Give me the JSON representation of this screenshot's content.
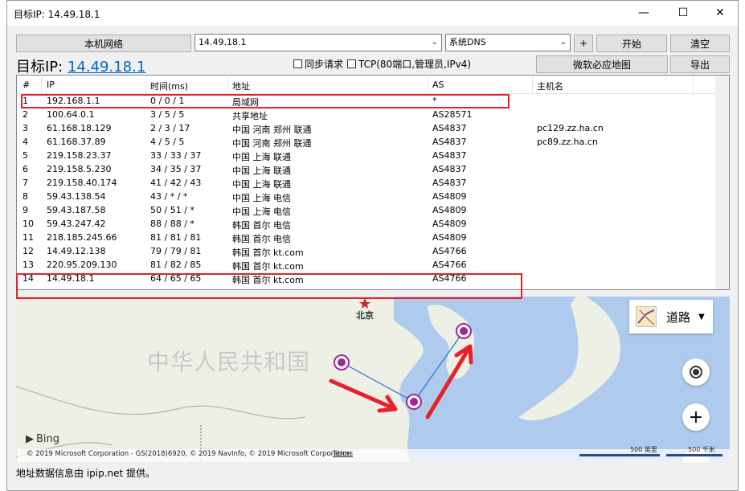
{
  "window": {
    "title": "目标IP: 14.49.18.1"
  },
  "toolbar": {
    "local_network": "本机网络",
    "ip_input_value": "14.49.18.1",
    "dns_select": "系统DNS",
    "plus": "+",
    "start": "开始",
    "clear": "清空",
    "bing_map": "微软必应地图",
    "export": "导出"
  },
  "target": {
    "label": "目标IP: ",
    "ip": "14.49.18.1"
  },
  "options": {
    "sync": "同步请求",
    "tcp": "TCP(80端口,管理员,IPv4)"
  },
  "table": {
    "headers": [
      "#",
      "IP",
      "时间(ms)",
      "地址",
      "AS",
      "主机名"
    ],
    "rows": [
      {
        "n": "1",
        "ip": "192.168.1.1",
        "time": "0 / 0 / 1",
        "addr": "局域网",
        "as": "*",
        "host": ""
      },
      {
        "n": "2",
        "ip": "100.64.0.1",
        "time": "3 / 5 / 5",
        "addr": "共享地址",
        "as": "AS28571",
        "host": ""
      },
      {
        "n": "3",
        "ip": "61.168.18.129",
        "time": "2 / 3 / 17",
        "addr": "中国 河南 郑州 联通",
        "as": "AS4837",
        "host": "pc129.zz.ha.cn"
      },
      {
        "n": "4",
        "ip": "61.168.37.89",
        "time": "4 / 5 / 5",
        "addr": "中国 河南 郑州 联通",
        "as": "AS4837",
        "host": "pc89.zz.ha.cn"
      },
      {
        "n": "5",
        "ip": "219.158.23.37",
        "time": "33 / 33 / 37",
        "addr": "中国 上海 联通",
        "as": "AS4837",
        "host": ""
      },
      {
        "n": "6",
        "ip": "219.158.5.230",
        "time": "34 / 35 / 37",
        "addr": "中国 上海 联通",
        "as": "AS4837",
        "host": ""
      },
      {
        "n": "7",
        "ip": "219.158.40.174",
        "time": "41 / 42 / 43",
        "addr": "中国 上海 联通",
        "as": "AS4837",
        "host": ""
      },
      {
        "n": "8",
        "ip": "59.43.138.54",
        "time": "43 / * / *",
        "addr": "中国 上海 电信",
        "as": "AS4809",
        "host": ""
      },
      {
        "n": "9",
        "ip": "59.43.187.58",
        "time": "50 / 51 / *",
        "addr": "中国 上海 电信",
        "as": "AS4809",
        "host": ""
      },
      {
        "n": "10",
        "ip": "59.43.247.42",
        "time": "88 / 88 / *",
        "addr": "韩国 首尔 电信",
        "as": "AS4809",
        "host": ""
      },
      {
        "n": "11",
        "ip": "218.185.245.66",
        "time": "81 / 81 / 81",
        "addr": "韩国 首尔 电信",
        "as": "AS4809",
        "host": ""
      },
      {
        "n": "12",
        "ip": "14.49.12.138",
        "time": "79 / 79 / 81",
        "addr": "韩国 首尔 kt.com",
        "as": "AS4766",
        "host": ""
      },
      {
        "n": "13",
        "ip": "220.95.209.130",
        "time": "81 / 82 / 85",
        "addr": "韩国 首尔 kt.com",
        "as": "AS4766",
        "host": ""
      },
      {
        "n": "14",
        "ip": "14.49.18.1",
        "time": "64 / 65 / 65",
        "addr": "韩国 首尔 kt.com",
        "as": "AS4766",
        "host": ""
      }
    ]
  },
  "map": {
    "city_beijing": "北京",
    "country_label": "中华人民共和国",
    "map_type": "道路",
    "bing": "Bing",
    "copyright": "© 2019 Microsoft Corporation - GS(2018)6920, © 2019 NavInfo, © 2019 Microsoft Corporation",
    "terms": "Terms",
    "scale_miles": "500 英里",
    "scale_km": "500 千米"
  },
  "status": "地址数据信息由 ipip.net 提供。",
  "colors": {
    "highlight": "#e8202a",
    "route": "#2a6fd6",
    "marker": "#a0269a",
    "link": "#0066cc"
  }
}
